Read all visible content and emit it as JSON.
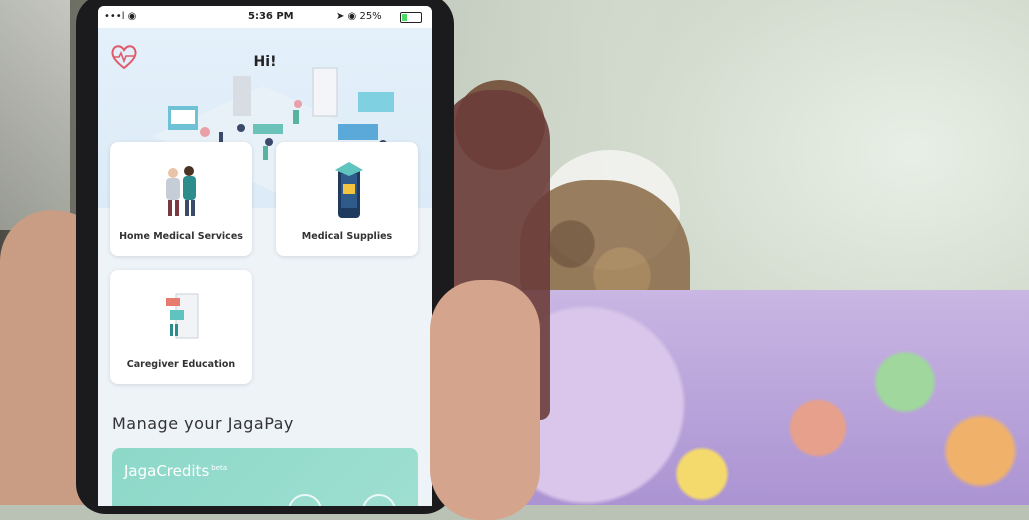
{
  "status_bar": {
    "signal": "•••l ◉",
    "time": "5:36 PM",
    "right": "➤ ◉ 25%"
  },
  "header": {
    "greeting": "Hi!",
    "logo_icon": "heart-pulse-icon"
  },
  "services": [
    {
      "label": "Home Medical Services",
      "icon": "doctor-patient-icon"
    },
    {
      "label": "Medical Supplies",
      "icon": "phone-box-icon"
    },
    {
      "label": "Caregiver Education",
      "icon": "caregiver-screen-icon"
    }
  ],
  "section": {
    "title": "Manage your JagaPay"
  },
  "credits": {
    "title": "JagaCredits",
    "badge": "beta"
  },
  "colors": {
    "accent": "#e05a6a",
    "credit_card": "#8dd8c9",
    "screen_bg": "#eef3f8"
  }
}
